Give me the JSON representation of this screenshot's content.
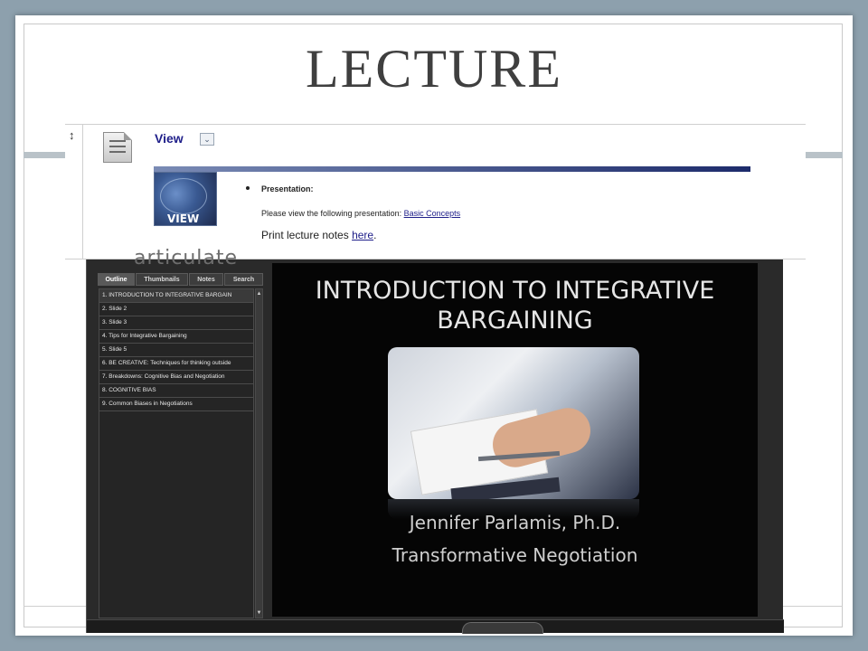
{
  "slide": {
    "title": "LECTURE"
  },
  "blackboard": {
    "resize_glyph": "↕",
    "doc_icon": "document-icon",
    "view_label": "View",
    "view_chevron_icon": "double-chevron-down-icon",
    "view_chevron_glyph": "⌄",
    "thumbnail_label": "VIEW",
    "presentation_label": "Presentation:",
    "presentation_text": "Please view the following presentation:",
    "presentation_link": "Basic Concepts",
    "print_text": "Print lecture notes",
    "print_link": "here",
    "print_period": "."
  },
  "player": {
    "brand": "articulate",
    "tabs": [
      {
        "label": "Outline",
        "active": true
      },
      {
        "label": "Thumbnails",
        "active": false
      },
      {
        "label": "Notes",
        "active": false
      },
      {
        "label": "Search",
        "active": false
      }
    ],
    "outline": [
      "1. INTRODUCTION TO  INTEGRATIVE BARGAIN",
      "2. Slide 2",
      "3. Slide 3",
      "4. Tips for Integrative Bargaining",
      "5. Slide 5",
      "6. BE CREATIVE: Techniques for thinking outside",
      "7. Breakdowns: Cognitive Bias and Negotiation",
      "8. COGNITIVE BIAS",
      "9. Common Biases in Negotiations"
    ],
    "scroll_up_glyph": "▲",
    "scroll_down_glyph": "▼",
    "stage": {
      "title_line1": "INTRODUCTION TO  INTEGRATIVE",
      "title_line2": "BARGAINING",
      "author": "Jennifer Parlamis, Ph.D.",
      "org": "Transformative Negotiation"
    }
  }
}
